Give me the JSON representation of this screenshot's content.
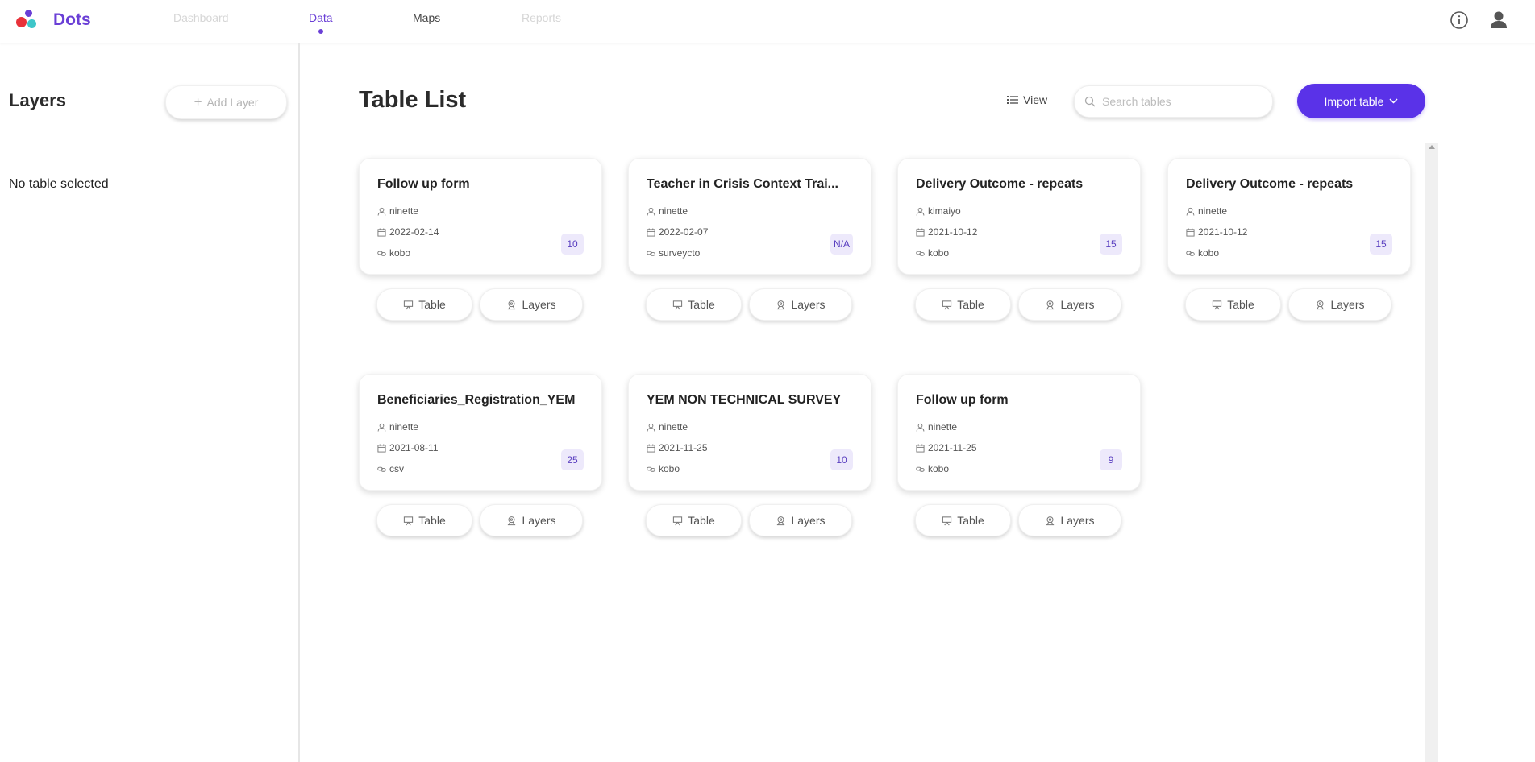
{
  "app": {
    "brand": "Dots"
  },
  "nav": [
    {
      "label": "Dashboard",
      "state": "disabled"
    },
    {
      "label": "Data",
      "state": "active"
    },
    {
      "label": "Maps",
      "state": "normal"
    },
    {
      "label": "Reports",
      "state": "disabled"
    }
  ],
  "topbar_icons": {
    "info": "info-icon",
    "user": "user-icon"
  },
  "left_panel": {
    "title": "Layers",
    "add_layer_label": "Add Layer",
    "empty_text": "No table selected"
  },
  "main": {
    "title": "Table List",
    "view_label": "View",
    "search_placeholder": "Search tables",
    "import_label": "Import table"
  },
  "cards": [
    {
      "title": "Follow up form",
      "owner": "ninette",
      "date": "2022-02-14",
      "source": "kobo",
      "count": "10",
      "table_label": "Table",
      "layers_label": "Layers"
    },
    {
      "title": "Teacher in Crisis Context Trai...",
      "owner": "ninette",
      "date": "2022-02-07",
      "source": "surveycto",
      "count": "N/A",
      "table_label": "Table",
      "layers_label": "Layers"
    },
    {
      "title": "Delivery Outcome - repeats",
      "owner": "kimaiyo",
      "date": "2021-10-12",
      "source": "kobo",
      "count": "15",
      "table_label": "Table",
      "layers_label": "Layers"
    },
    {
      "title": "Delivery Outcome - repeats",
      "owner": "ninette",
      "date": "2021-10-12",
      "source": "kobo",
      "count": "15",
      "table_label": "Table",
      "layers_label": "Layers"
    },
    {
      "title": "Beneficiaries_Registration_YEM",
      "owner": "ninette",
      "date": "2021-08-11",
      "source": "csv",
      "count": "25",
      "table_label": "Table",
      "layers_label": "Layers"
    },
    {
      "title": "YEM NON TECHNICAL SURVEY",
      "owner": "ninette",
      "date": "2021-11-25",
      "source": "kobo",
      "count": "10",
      "table_label": "Table",
      "layers_label": "Layers"
    },
    {
      "title": "Follow up form",
      "owner": "ninette",
      "date": "2021-11-25",
      "source": "kobo",
      "count": "9",
      "table_label": "Table",
      "layers_label": "Layers"
    }
  ],
  "colors": {
    "brand": "#6a3fd6",
    "accent": "#5a32e8",
    "nav_disabled": "#d6d6d6",
    "nav_normal": "#444444",
    "badge_bg": "#ede9fb"
  }
}
